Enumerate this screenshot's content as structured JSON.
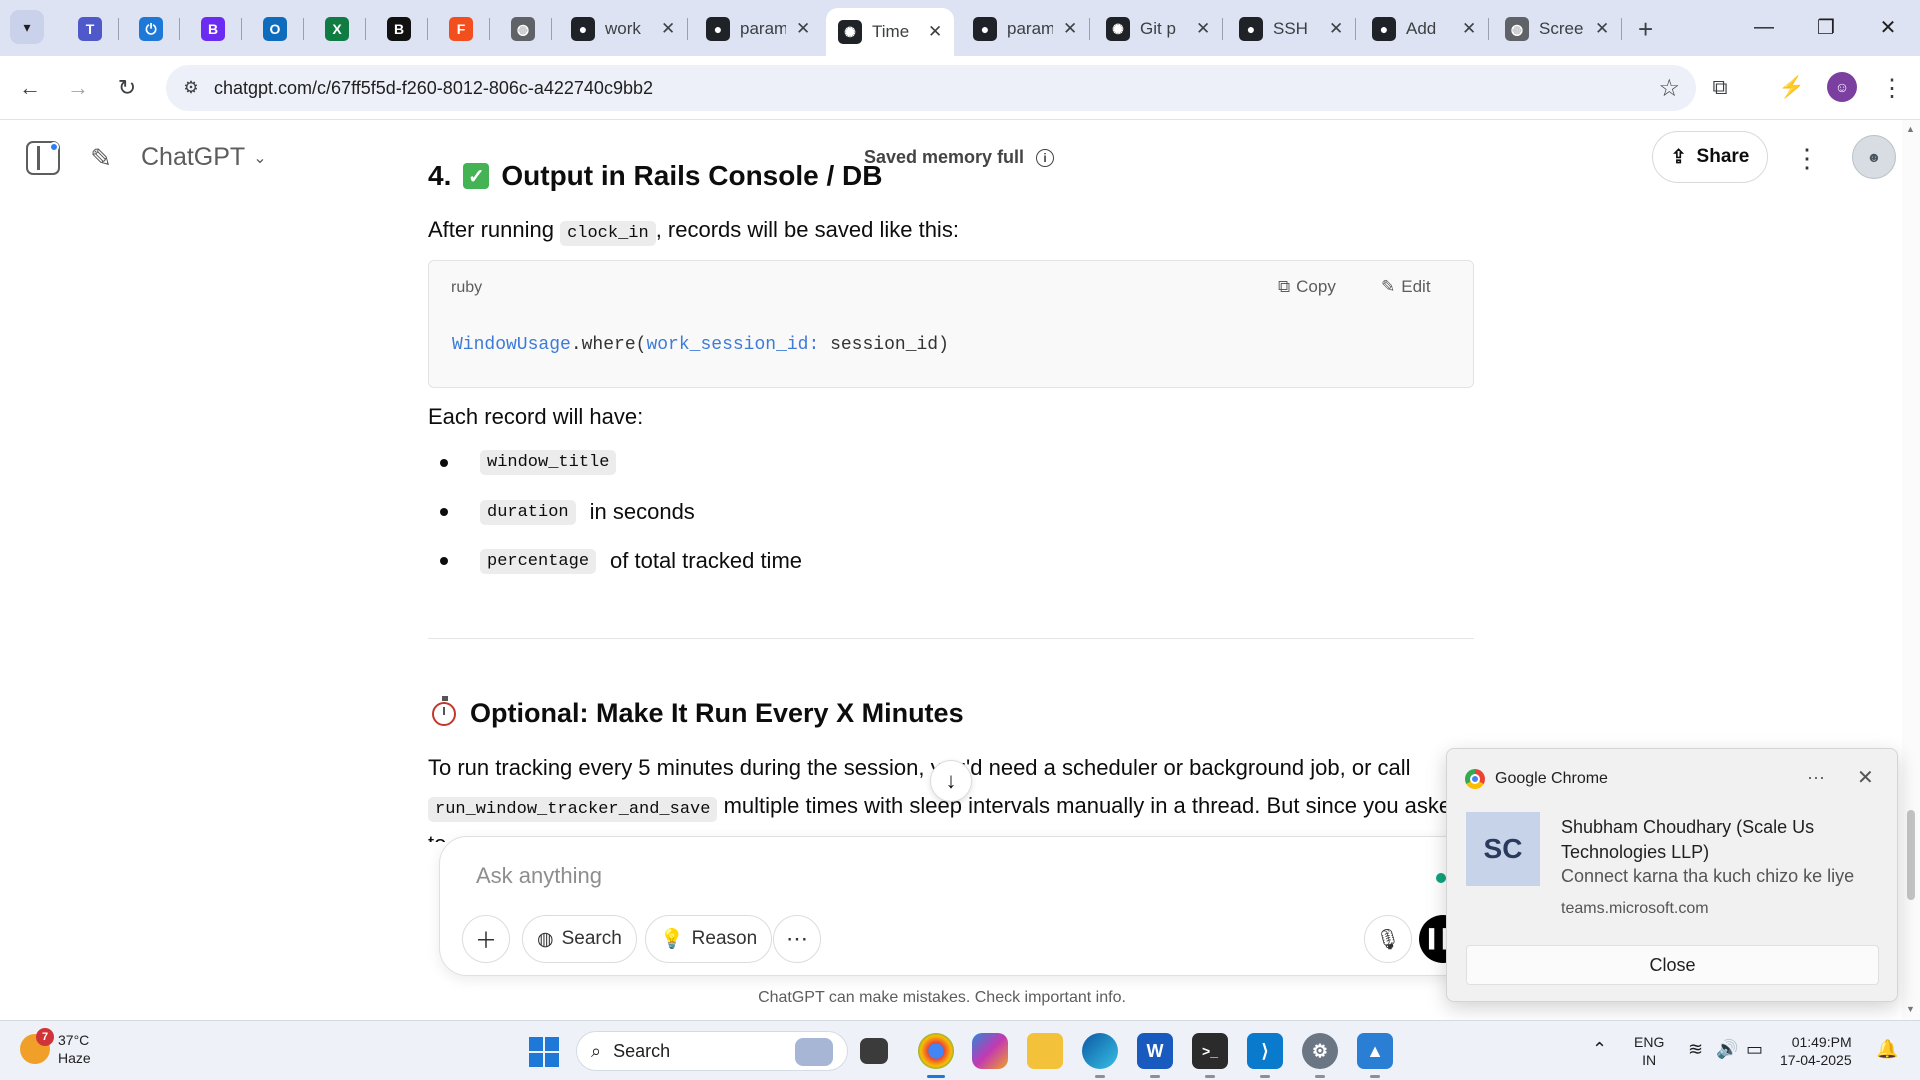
{
  "browser": {
    "tabs": [
      {
        "label": "",
        "icon": "teams-icon",
        "color": "#5059c9",
        "glyph": "T"
      },
      {
        "label": "",
        "icon": "power-icon",
        "color": "#1e78d7",
        "glyph": "⏻"
      },
      {
        "label": "",
        "icon": "b-purple-icon",
        "color": "#6b2bf0",
        "glyph": "B"
      },
      {
        "label": "",
        "icon": "outlook-icon",
        "color": "#0f6cbd",
        "glyph": "O"
      },
      {
        "label": "",
        "icon": "excel-icon",
        "color": "#107c41",
        "glyph": "X"
      },
      {
        "label": "",
        "icon": "b-black-icon",
        "color": "#111111",
        "glyph": "B"
      },
      {
        "label": "",
        "icon": "figma-icon",
        "color": "#f24e1e",
        "glyph": "F"
      },
      {
        "label": "",
        "icon": "globe-icon",
        "color": "#5f6368",
        "glyph": "◍"
      },
      {
        "label": "work",
        "icon": "github-icon",
        "color": "#1f2328",
        "glyph": "●"
      },
      {
        "label": "param",
        "icon": "github-icon",
        "color": "#1f2328",
        "glyph": "●"
      },
      {
        "label": "Time",
        "icon": "chatgpt-icon",
        "color": "#1f2328",
        "glyph": "✺"
      },
      {
        "label": "param",
        "icon": "github-icon",
        "color": "#1f2328",
        "glyph": "●"
      },
      {
        "label": "Git p",
        "icon": "chatgpt-icon",
        "color": "#1f2328",
        "glyph": "✺"
      },
      {
        "label": "SSH",
        "icon": "github-icon",
        "color": "#1f2328",
        "glyph": "●"
      },
      {
        "label": "Add",
        "icon": "github-icon",
        "color": "#1f2328",
        "glyph": "●"
      },
      {
        "label": "Scree",
        "icon": "globe-icon",
        "color": "#5f6368",
        "glyph": "◍"
      }
    ],
    "url": "chatgpt.com/c/67ff5f5d-f260-8012-806c-a422740c9bb2"
  },
  "chatgpt": {
    "model_label": "ChatGPT",
    "memory_label": "Saved memory full",
    "share_label": "Share"
  },
  "content": {
    "heading_number": "4.",
    "heading_text": "Output in Rails Console / DB",
    "after_pre": "After running ",
    "after_code": "clock_in",
    "after_post": ", records will be saved like this:",
    "code_lang": "ruby",
    "copy_label": "Copy",
    "edit_label": "Edit",
    "code_class": "WindowUsage",
    "code_method": ".where(",
    "code_sym": "work_session_id:",
    "code_arg": " session_id)",
    "record_intro": "Each record will have:",
    "bullets": [
      {
        "code": "window_title",
        "text": ""
      },
      {
        "code": "duration",
        "text": "in seconds"
      },
      {
        "code": "percentage",
        "text": "of total tracked time"
      }
    ],
    "optional_heading": "Optional: Make It Run Every X Minutes",
    "para_line1": "To run tracking every 5 minutes during the session, you'd need a scheduler or background job, or call",
    "para_code": "run_window_tracker_and_save",
    "para_line2": "multiple times with sleep intervals manually in a thread. But since you asked",
    "para_line3": "to"
  },
  "composer": {
    "placeholder": "Ask anything",
    "search_label": "Search",
    "reason_label": "Reason",
    "disclaimer": "ChatGPT can make mistakes. Check important info."
  },
  "notification": {
    "app": "Google Chrome",
    "avatar_initials": "SC",
    "title": "Shubham Choudhary (Scale Us Technologies LLP)",
    "body": "Connect karna tha kuch chizo ke liye",
    "source": "teams.microsoft.com",
    "close_label": "Close"
  },
  "taskbar": {
    "weather_badge": "7",
    "temperature": "37°C",
    "condition": "Haze",
    "search_label": "Search",
    "lang_line1": "ENG",
    "lang_line2": "IN",
    "time": "01:49:PM",
    "date": "17-04-2025"
  }
}
